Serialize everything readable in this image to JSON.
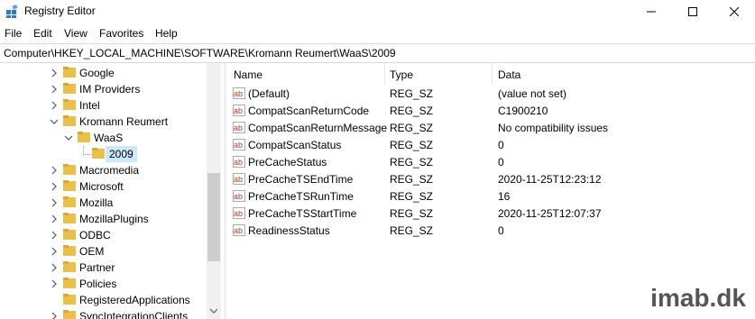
{
  "window": {
    "title": "Registry Editor",
    "minimize_icon": "minimize-icon",
    "maximize_icon": "maximize-icon",
    "close_icon": "close-icon"
  },
  "menu": [
    "File",
    "Edit",
    "View",
    "Favorites",
    "Help"
  ],
  "address": "Computer\\HKEY_LOCAL_MACHINE\\SOFTWARE\\Kromann Reumert\\WaaS\\2009",
  "tree": [
    {
      "label": "Google"
    },
    {
      "label": "IM Providers"
    },
    {
      "label": "Intel"
    },
    {
      "label": "Kromann Reumert"
    },
    {
      "label": "WaaS"
    },
    {
      "label": "2009"
    },
    {
      "label": "Macromedia"
    },
    {
      "label": "Microsoft"
    },
    {
      "label": "Mozilla"
    },
    {
      "label": "MozillaPlugins"
    },
    {
      "label": "ODBC"
    },
    {
      "label": "OEM"
    },
    {
      "label": "Partner"
    },
    {
      "label": "Policies"
    },
    {
      "label": "RegisteredApplications"
    },
    {
      "label": "SyncIntegrationClients"
    }
  ],
  "columns": {
    "name": "Name",
    "type": "Type",
    "data": "Data"
  },
  "values": [
    {
      "name": "(Default)",
      "type": "REG_SZ",
      "data": "(value not set)"
    },
    {
      "name": "CompatScanReturnCode",
      "type": "REG_SZ",
      "data": "C1900210"
    },
    {
      "name": "CompatScanReturnMessage",
      "type": "REG_SZ",
      "data": "No compatibility issues"
    },
    {
      "name": "CompatScanStatus",
      "type": "REG_SZ",
      "data": "0"
    },
    {
      "name": "PreCacheStatus",
      "type": "REG_SZ",
      "data": "0"
    },
    {
      "name": "PreCacheTSEndTime",
      "type": "REG_SZ",
      "data": "2020-11-25T12:23:12"
    },
    {
      "name": "PreCacheTSRunTime",
      "type": "REG_SZ",
      "data": "16"
    },
    {
      "name": "PreCacheTSStartTime",
      "type": "REG_SZ",
      "data": "2020-11-25T12:07:37"
    },
    {
      "name": "ReadinessStatus",
      "type": "REG_SZ",
      "data": "0"
    }
  ],
  "watermark": {
    "name": "imab",
    "suffix": ".dk"
  },
  "colors": {
    "folder": "#e8c04a",
    "selection": "#cce8ff",
    "string_icon": "#c0392b"
  }
}
